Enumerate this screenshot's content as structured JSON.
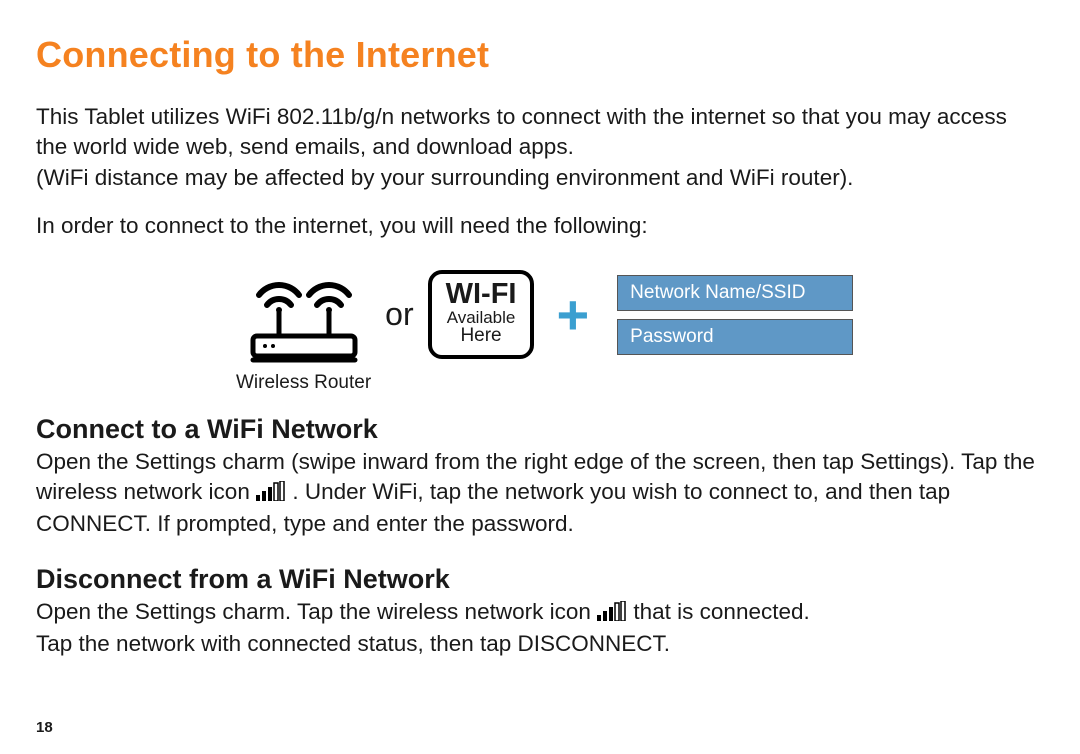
{
  "title": "Connecting to the Internet",
  "para1": "This Tablet utilizes WiFi 802.11b/g/n networks to connect with the internet so that you may access the world wide web, send emails, and download apps.",
  "para1b": "(WiFi distance may be affected by your surrounding environment and WiFi router).",
  "para2": "In order to connect to the internet, you will need the following:",
  "diagram": {
    "router_label": "Wireless Router",
    "or": "or",
    "wifi_sign_line1": "WI-FI",
    "wifi_sign_line2": "Available",
    "wifi_sign_line3": "Here",
    "plus": "+",
    "cred1": "Network Name/SSID",
    "cred2": "Password"
  },
  "section_connect": {
    "heading": "Connect to a WiFi Network",
    "text_a": "Open the Settings charm (swipe inward from the right edge of the screen, then tap Settings). Tap the wireless network icon ",
    "text_b": ". Under WiFi, tap the network you wish to connect to, and then tap CONNECT. If prompted, type and enter the password."
  },
  "section_disconnect": {
    "heading": "Disconnect from a WiFi Network",
    "text_a": "Open the Settings charm. Tap the wireless network icon ",
    "text_b": " that is connected.",
    "text_c": "Tap the network with connected status, then tap DISCONNECT."
  },
  "page_number": "18"
}
